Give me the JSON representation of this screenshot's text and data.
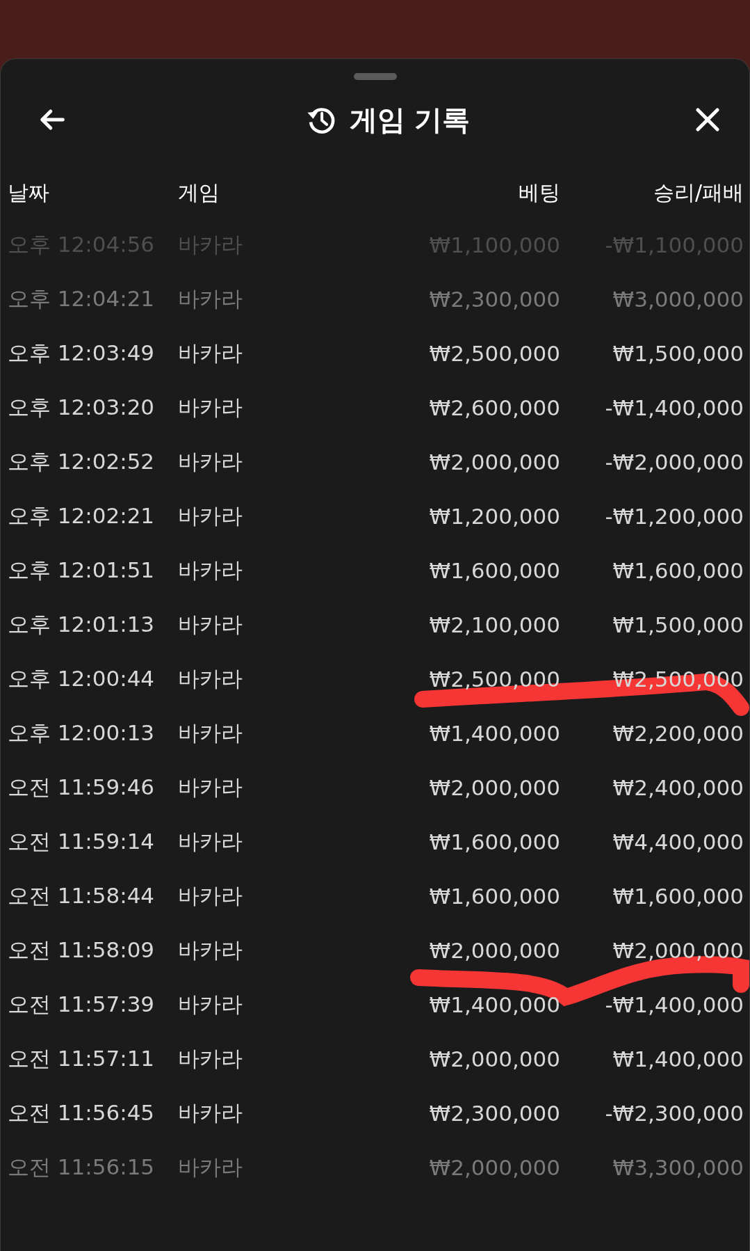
{
  "sheet": {
    "title": "게임 기록"
  },
  "table": {
    "columns": [
      "날짜",
      "게임",
      "베팅",
      "승리/패배"
    ],
    "rows": [
      {
        "date": "오후 12:04:56",
        "game": "바카라",
        "bet": "₩1,100,000",
        "result": "-₩1,100,000",
        "kind": "faded"
      },
      {
        "date": "오후 12:04:21",
        "game": "바카라",
        "bet": "₩2,300,000",
        "result": "₩3,000,000",
        "kind": "dim"
      },
      {
        "date": "오후 12:03:49",
        "game": "바카라",
        "bet": "₩2,500,000",
        "result": "₩1,500,000"
      },
      {
        "date": "오후 12:03:20",
        "game": "바카라",
        "bet": "₩2,600,000",
        "result": "-₩1,400,000"
      },
      {
        "date": "오후 12:02:52",
        "game": "바카라",
        "bet": "₩2,000,000",
        "result": "-₩2,000,000"
      },
      {
        "date": "오후 12:02:21",
        "game": "바카라",
        "bet": "₩1,200,000",
        "result": "-₩1,200,000"
      },
      {
        "date": "오후 12:01:51",
        "game": "바카라",
        "bet": "₩1,600,000",
        "result": "₩1,600,000"
      },
      {
        "date": "오후 12:01:13",
        "game": "바카라",
        "bet": "₩2,100,000",
        "result": "₩1,500,000"
      },
      {
        "date": "오후 12:00:44",
        "game": "바카라",
        "bet": "₩2,500,000",
        "result": "₩2,500,000"
      },
      {
        "date": "오후 12:00:13",
        "game": "바카라",
        "bet": "₩1,400,000",
        "result": "₩2,200,000"
      },
      {
        "date": "오전 11:59:46",
        "game": "바카라",
        "bet": "₩2,000,000",
        "result": "₩2,400,000"
      },
      {
        "date": "오전 11:59:14",
        "game": "바카라",
        "bet": "₩1,600,000",
        "result": "₩4,400,000"
      },
      {
        "date": "오전 11:58:44",
        "game": "바카라",
        "bet": "₩1,600,000",
        "result": "₩1,600,000"
      },
      {
        "date": "오전 11:58:09",
        "game": "바카라",
        "bet": "₩2,000,000",
        "result": "₩2,000,000"
      },
      {
        "date": "오전 11:57:39",
        "game": "바카라",
        "bet": "₩1,400,000",
        "result": "-₩1,400,000"
      },
      {
        "date": "오전 11:57:11",
        "game": "바카라",
        "bet": "₩2,000,000",
        "result": "₩1,400,000"
      },
      {
        "date": "오전 11:56:45",
        "game": "바카라",
        "bet": "₩2,300,000",
        "result": "-₩2,300,000"
      },
      {
        "date": "오전 11:56:15",
        "game": "바카라",
        "bet": "₩2,000,000",
        "result": "₩3,300,000",
        "kind": "dim"
      }
    ]
  }
}
